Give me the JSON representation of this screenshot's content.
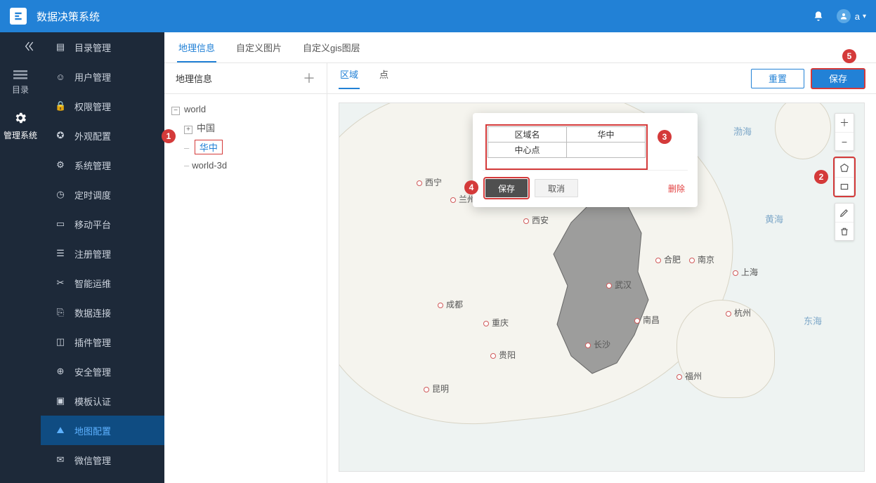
{
  "header": {
    "app_title": "数据决策系统",
    "user_name": "a"
  },
  "rail": {
    "items": [
      {
        "label": "目录"
      },
      {
        "label": "管理系统"
      }
    ]
  },
  "sidebar": {
    "items": [
      {
        "label": "目录管理"
      },
      {
        "label": "用户管理"
      },
      {
        "label": "权限管理"
      },
      {
        "label": "外观配置"
      },
      {
        "label": "系统管理"
      },
      {
        "label": "定时调度"
      },
      {
        "label": "移动平台"
      },
      {
        "label": "注册管理"
      },
      {
        "label": "智能运维"
      },
      {
        "label": "数据连接"
      },
      {
        "label": "插件管理"
      },
      {
        "label": "安全管理"
      },
      {
        "label": "模板认证"
      },
      {
        "label": "地图配置"
      },
      {
        "label": "微信管理"
      }
    ]
  },
  "tabs": {
    "items": [
      {
        "label": "地理信息"
      },
      {
        "label": "自定义图片"
      },
      {
        "label": "自定义gis图层"
      }
    ]
  },
  "treepanel": {
    "title": "地理信息",
    "nodes": {
      "world": "world",
      "china": "中国",
      "huazhong": "华中",
      "world3d": "world-3d"
    }
  },
  "subtabs": {
    "items": [
      {
        "label": "区域"
      },
      {
        "label": "点"
      }
    ]
  },
  "buttons": {
    "reset": "重置",
    "save": "保存"
  },
  "popup": {
    "region_name_label": "区域名",
    "region_name_value": "华中",
    "center_label": "中心点",
    "center_value": "",
    "save": "保存",
    "cancel": "取消",
    "delete": "删除"
  },
  "annotations": {
    "a1": "1",
    "a2": "2",
    "a3": "3",
    "a4": "4",
    "a5": "5"
  },
  "map": {
    "sea1": "渤海",
    "sea2": "黄海",
    "sea3": "东海",
    "cities": {
      "xining": "西宁",
      "lanzhou": "兰州",
      "xian": "西安",
      "chengdu": "成都",
      "chongqing": "重庆",
      "guiyang": "贵阳",
      "kunming": "昆明",
      "changsha": "长沙",
      "wuhan": "武汉",
      "nanchang": "南昌",
      "hefei": "合肥",
      "nanjing": "南京",
      "shanghai": "上海",
      "hangzhou": "杭州",
      "fuzhou": "福州"
    }
  }
}
